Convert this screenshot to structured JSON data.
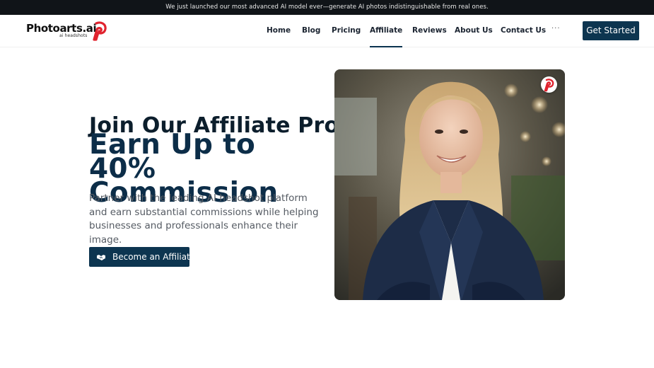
{
  "announcement": {
    "text": "We just launched our most advanced AI model ever—generate AI photos indistinguishable from real ones."
  },
  "brand": {
    "name": "Photoarts.ai",
    "tagline": "ai headshots",
    "accent": "#e0232e",
    "primary": "#0d3550"
  },
  "nav": {
    "items": [
      {
        "label": "Home"
      },
      {
        "label": "Blog"
      },
      {
        "label": "Pricing"
      },
      {
        "label": "Affiliate",
        "active": true
      },
      {
        "label": "Reviews"
      },
      {
        "label": "About Us"
      },
      {
        "label": "Contact Us"
      }
    ],
    "more_label": "···",
    "cta_label": "Get Started"
  },
  "hero": {
    "title_line1": "Join Our Affiliate Program",
    "title_line2": "Earn Up to 40% Commission",
    "description": "Partner with the leading AI headshot platform and earn substantial commissions while helping businesses and professionals enhance their image.",
    "button_label": "Become an Affiliate",
    "button_icon": "handshake-icon",
    "image_subject": "portrait-photo",
    "badge_icon": "photoarts-logo-icon"
  }
}
